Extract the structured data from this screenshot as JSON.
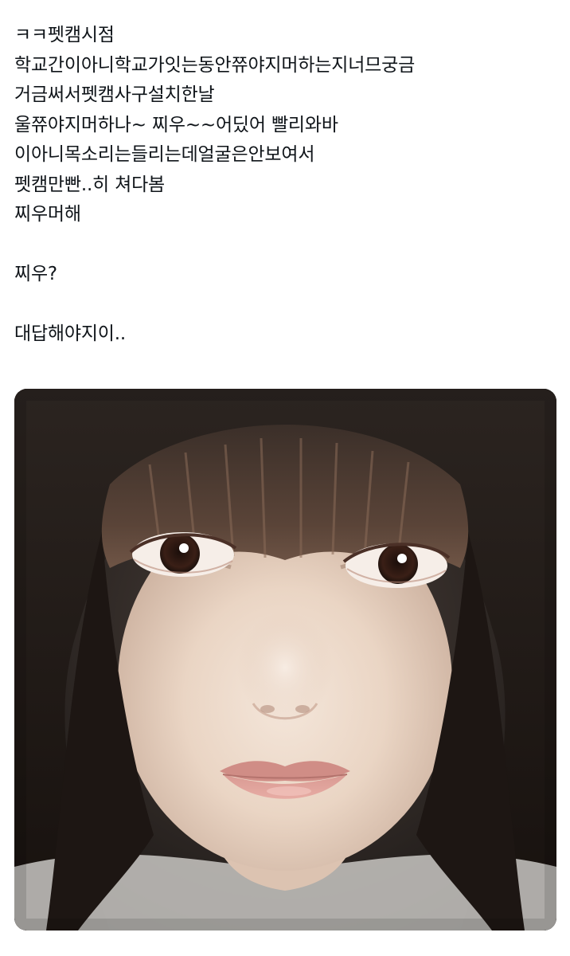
{
  "post": {
    "lines": [
      "ㅋㅋ펫캠시점",
      "학교간이아니학교가잇는동안쮸야지머하는지너므궁금",
      "거금써서펫캠사구설치한날",
      "울쮸야지머하나~ 찌우~~어딨어 빨리와바",
      "이아니목소리는들리는데얼굴은안보여서",
      "펫캠만빤..히 쳐다봄",
      "찌우머해",
      "",
      "찌우?",
      "",
      "대답해야지이.."
    ]
  },
  "media": {
    "type": "photo",
    "subject": "close-up-face-photo"
  }
}
